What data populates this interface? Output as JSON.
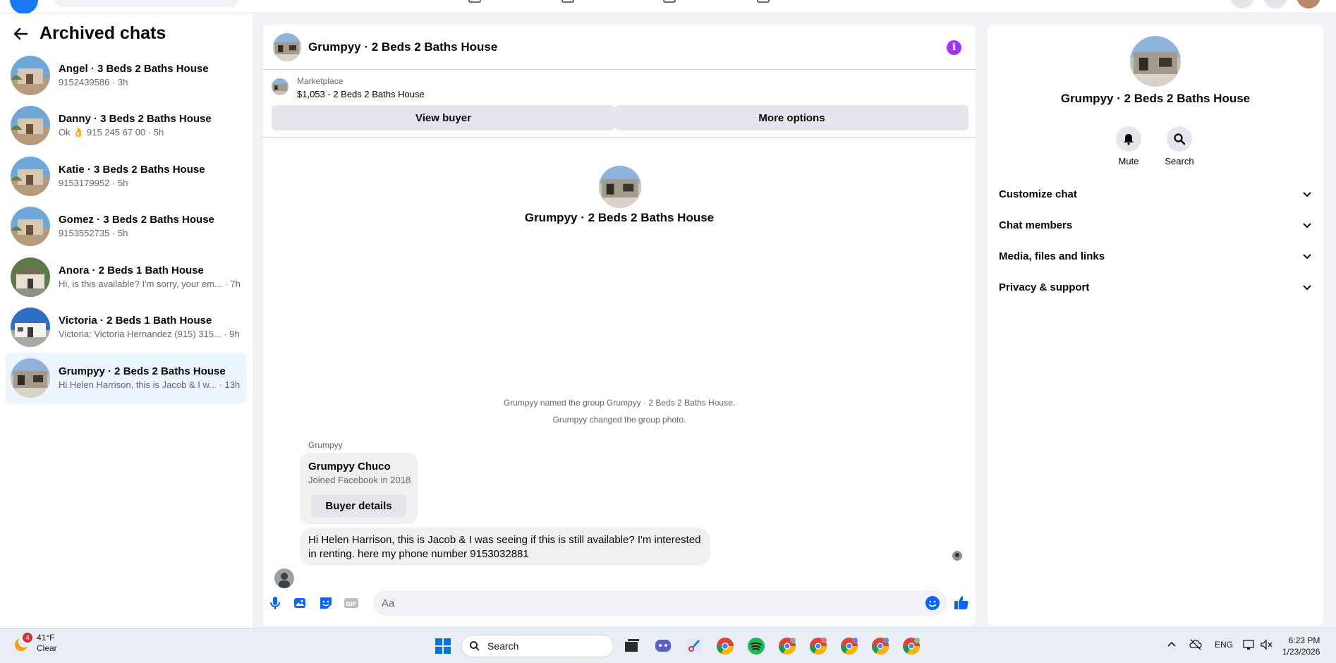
{
  "sidebar": {
    "title": "Archived chats",
    "chats": [
      {
        "name": "Angel · 3 Beds 2 Baths House",
        "snippet": "9152439586 · 3h"
      },
      {
        "name": "Danny · 3 Beds 2 Baths House",
        "snippet": "Ok 👌 915 245 67 00 · 5h"
      },
      {
        "name": "Katie · 3 Beds 2 Baths House",
        "snippet": "9153179952 · 5h"
      },
      {
        "name": "Gomez · 3 Beds 2 Baths House",
        "snippet": "9153552735 · 5h"
      },
      {
        "name": "Anora · 2 Beds 1 Bath House",
        "snippet": "Hi, is this available? I'm sorry, your em... · 7h"
      },
      {
        "name": "Victoria · 2 Beds 1 Bath House",
        "snippet": "Victoria: Victoria Hernandez (915) 315... · 9h"
      },
      {
        "name": "Grumpyy · 2 Beds 2 Baths House",
        "snippet": "Hi Helen Harrison, this is Jacob & I w... · 13h"
      }
    ]
  },
  "conversation": {
    "title": "Grumpyy · 2 Beds 2 Baths House",
    "marketplace_label": "Marketplace",
    "listing": "$1,053 - 2 Beds 2 Baths House",
    "view_buyer": "View buyer",
    "more_options": "More options",
    "center_name": "Grumpyy · 2 Beds 2 Baths House",
    "system_msgs": [
      "Grumpyy named the group Grumpyy · 2 Beds 2 Baths House.",
      "Grumpyy changed the group photo."
    ],
    "sender": "Grumpyy",
    "buyer_card": {
      "name": "Grumpyy Chuco",
      "joined": "Joined Facebook in 2018",
      "button": "Buyer details"
    },
    "message": "Hi Helen Harrison, this is Jacob & I was seeing if this is still available? I'm interested in renting. here my phone number 9153032881",
    "composer_placeholder": "Aa"
  },
  "right_panel": {
    "name": "Grumpyy · 2 Beds 2 Baths House",
    "actions": [
      "Mute",
      "Search"
    ],
    "sections": [
      "Customize chat",
      "Chat members",
      "Media, files and links",
      "Privacy & support"
    ]
  },
  "taskbar": {
    "weather_badge": "4",
    "temperature": "41°F",
    "condition": "Clear",
    "search_label": "Search",
    "language": "ENG",
    "time": "6:23 PM",
    "date": "1/23/2026"
  },
  "colors": {
    "accent": "#1877f2",
    "active_chat": "#ebf5ff",
    "info": "#a033ff"
  }
}
